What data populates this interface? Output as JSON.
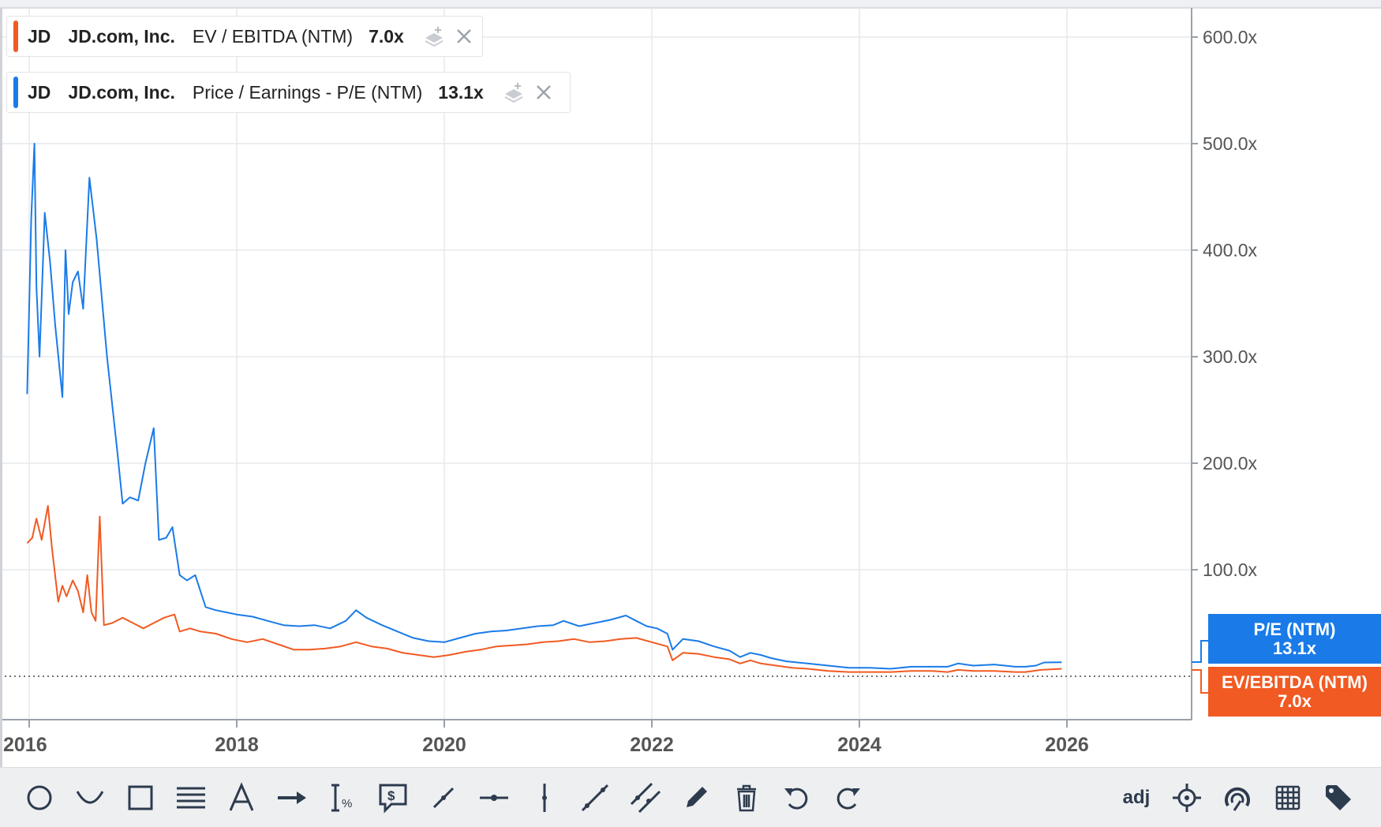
{
  "chart_data": {
    "type": "line",
    "x_ticks": [
      "2016",
      "2018",
      "2020",
      "2022",
      "2024",
      "2026"
    ],
    "y_ticks": [
      "600.0x",
      "500.0x",
      "400.0x",
      "300.0x",
      "200.0x",
      "100.0x"
    ],
    "x_range": [
      2015.97,
      2026.25
    ],
    "y_range": [
      0,
      600
    ],
    "series": [
      {
        "name": "Price / Earnings - P/E (NTM)",
        "color": "#1a7be8",
        "points": [
          [
            2015.98,
            265
          ],
          [
            2016.02,
            430
          ],
          [
            2016.05,
            500
          ],
          [
            2016.07,
            365
          ],
          [
            2016.1,
            300
          ],
          [
            2016.15,
            435
          ],
          [
            2016.2,
            390
          ],
          [
            2016.25,
            330
          ],
          [
            2016.32,
            262
          ],
          [
            2016.35,
            400
          ],
          [
            2016.38,
            340
          ],
          [
            2016.42,
            370
          ],
          [
            2016.47,
            380
          ],
          [
            2016.52,
            345
          ],
          [
            2016.58,
            468
          ],
          [
            2016.65,
            410
          ],
          [
            2016.75,
            300
          ],
          [
            2016.85,
            210
          ],
          [
            2016.9,
            162
          ],
          [
            2016.97,
            168
          ],
          [
            2017.05,
            165
          ],
          [
            2017.12,
            200
          ],
          [
            2017.2,
            233
          ],
          [
            2017.25,
            128
          ],
          [
            2017.32,
            130
          ],
          [
            2017.38,
            140
          ],
          [
            2017.45,
            95
          ],
          [
            2017.52,
            90
          ],
          [
            2017.6,
            95
          ],
          [
            2017.7,
            65
          ],
          [
            2017.8,
            62
          ],
          [
            2017.9,
            60
          ],
          [
            2018.0,
            58
          ],
          [
            2018.15,
            56
          ],
          [
            2018.3,
            52
          ],
          [
            2018.45,
            48
          ],
          [
            2018.6,
            47
          ],
          [
            2018.75,
            48
          ],
          [
            2018.9,
            45
          ],
          [
            2019.05,
            52
          ],
          [
            2019.15,
            62
          ],
          [
            2019.25,
            55
          ],
          [
            2019.4,
            48
          ],
          [
            2019.55,
            42
          ],
          [
            2019.7,
            36
          ],
          [
            2019.85,
            33
          ],
          [
            2020.0,
            32
          ],
          [
            2020.15,
            36
          ],
          [
            2020.3,
            40
          ],
          [
            2020.45,
            42
          ],
          [
            2020.6,
            43
          ],
          [
            2020.75,
            45
          ],
          [
            2020.9,
            47
          ],
          [
            2021.05,
            48
          ],
          [
            2021.15,
            52
          ],
          [
            2021.3,
            47
          ],
          [
            2021.45,
            50
          ],
          [
            2021.6,
            53
          ],
          [
            2021.75,
            57
          ],
          [
            2021.85,
            52
          ],
          [
            2021.95,
            47
          ],
          [
            2022.05,
            45
          ],
          [
            2022.15,
            40
          ],
          [
            2022.2,
            25
          ],
          [
            2022.3,
            35
          ],
          [
            2022.45,
            33
          ],
          [
            2022.6,
            28
          ],
          [
            2022.75,
            24
          ],
          [
            2022.85,
            18
          ],
          [
            2022.95,
            22
          ],
          [
            2023.05,
            20
          ],
          [
            2023.15,
            17
          ],
          [
            2023.3,
            14
          ],
          [
            2023.5,
            12
          ],
          [
            2023.7,
            10
          ],
          [
            2023.9,
            8
          ],
          [
            2024.1,
            8
          ],
          [
            2024.3,
            7
          ],
          [
            2024.5,
            9
          ],
          [
            2024.7,
            9
          ],
          [
            2024.85,
            9
          ],
          [
            2024.95,
            12
          ],
          [
            2025.1,
            10
          ],
          [
            2025.3,
            11
          ],
          [
            2025.5,
            9
          ],
          [
            2025.6,
            9
          ],
          [
            2025.7,
            10
          ],
          [
            2025.78,
            13
          ],
          [
            2025.95,
            13.1
          ]
        ]
      },
      {
        "name": "EV / EBITDA (NTM)",
        "color": "#f15a22",
        "points": [
          [
            2015.98,
            125
          ],
          [
            2016.03,
            130
          ],
          [
            2016.07,
            148
          ],
          [
            2016.12,
            128
          ],
          [
            2016.18,
            160
          ],
          [
            2016.22,
            120
          ],
          [
            2016.28,
            70
          ],
          [
            2016.32,
            85
          ],
          [
            2016.36,
            75
          ],
          [
            2016.42,
            90
          ],
          [
            2016.47,
            80
          ],
          [
            2016.52,
            60
          ],
          [
            2016.56,
            95
          ],
          [
            2016.6,
            60
          ],
          [
            2016.64,
            52
          ],
          [
            2016.68,
            150
          ],
          [
            2016.72,
            48
          ],
          [
            2016.8,
            50
          ],
          [
            2016.9,
            55
          ],
          [
            2017.0,
            50
          ],
          [
            2017.1,
            45
          ],
          [
            2017.2,
            50
          ],
          [
            2017.3,
            55
          ],
          [
            2017.4,
            58
          ],
          [
            2017.45,
            42
          ],
          [
            2017.55,
            45
          ],
          [
            2017.65,
            42
          ],
          [
            2017.8,
            40
          ],
          [
            2017.95,
            35
          ],
          [
            2018.1,
            32
          ],
          [
            2018.25,
            35
          ],
          [
            2018.4,
            30
          ],
          [
            2018.55,
            25
          ],
          [
            2018.7,
            25
          ],
          [
            2018.85,
            26
          ],
          [
            2019.0,
            28
          ],
          [
            2019.15,
            32
          ],
          [
            2019.3,
            28
          ],
          [
            2019.45,
            26
          ],
          [
            2019.6,
            22
          ],
          [
            2019.75,
            20
          ],
          [
            2019.9,
            18
          ],
          [
            2020.05,
            20
          ],
          [
            2020.2,
            23
          ],
          [
            2020.35,
            25
          ],
          [
            2020.5,
            28
          ],
          [
            2020.65,
            29
          ],
          [
            2020.8,
            30
          ],
          [
            2020.95,
            32
          ],
          [
            2021.1,
            33
          ],
          [
            2021.25,
            35
          ],
          [
            2021.4,
            32
          ],
          [
            2021.55,
            33
          ],
          [
            2021.7,
            35
          ],
          [
            2021.85,
            36
          ],
          [
            2022.0,
            32
          ],
          [
            2022.15,
            28
          ],
          [
            2022.2,
            15
          ],
          [
            2022.3,
            22
          ],
          [
            2022.45,
            21
          ],
          [
            2022.6,
            18
          ],
          [
            2022.75,
            16
          ],
          [
            2022.85,
            12
          ],
          [
            2022.95,
            15
          ],
          [
            2023.05,
            12
          ],
          [
            2023.2,
            10
          ],
          [
            2023.35,
            8
          ],
          [
            2023.5,
            7
          ],
          [
            2023.7,
            5
          ],
          [
            2023.9,
            4
          ],
          [
            2024.1,
            4
          ],
          [
            2024.3,
            4
          ],
          [
            2024.5,
            5
          ],
          [
            2024.7,
            5
          ],
          [
            2024.85,
            4
          ],
          [
            2024.95,
            6
          ],
          [
            2025.1,
            5
          ],
          [
            2025.3,
            5
          ],
          [
            2025.5,
            4
          ],
          [
            2025.6,
            4
          ],
          [
            2025.75,
            6
          ],
          [
            2025.95,
            7.0
          ]
        ]
      }
    ],
    "gridlines": true,
    "legend_placement": "top-left",
    "baseline_dotted": 0
  },
  "legend": [
    {
      "ticker": "JD",
      "company": "JD.com, Inc.",
      "metric": "EV / EBITDA (NTM)",
      "value": "7.0x",
      "color": "#f15a22"
    },
    {
      "ticker": "JD",
      "company": "JD.com, Inc.",
      "metric": "Price / Earnings - P/E (NTM)",
      "value": "13.1x",
      "color": "#1a7be8"
    }
  ],
  "end_labels": {
    "pe": {
      "name": "P/E (NTM)",
      "value": "13.1x",
      "color": "#1a7be8"
    },
    "ev": {
      "name": "EV/EBITDA (NTM)",
      "value": "7.0x",
      "color": "#f15a22"
    }
  },
  "toolbar": {
    "adj_label": "adj",
    "tools": [
      "ellipse-icon",
      "arc-icon",
      "rectangle-icon",
      "fib-lines-icon",
      "text-icon",
      "arrow-icon",
      "percent-measure-icon",
      "price-note-icon",
      "trendline-icon",
      "horizontal-line-icon",
      "vertical-line-icon",
      "ray-icon",
      "parallel-channel-icon",
      "pencil-icon",
      "trash-icon",
      "undo-icon",
      "redo-icon"
    ],
    "right_tools": [
      "crosshair-icon",
      "magnet-icon",
      "grid-icon",
      "tag-icon"
    ]
  }
}
